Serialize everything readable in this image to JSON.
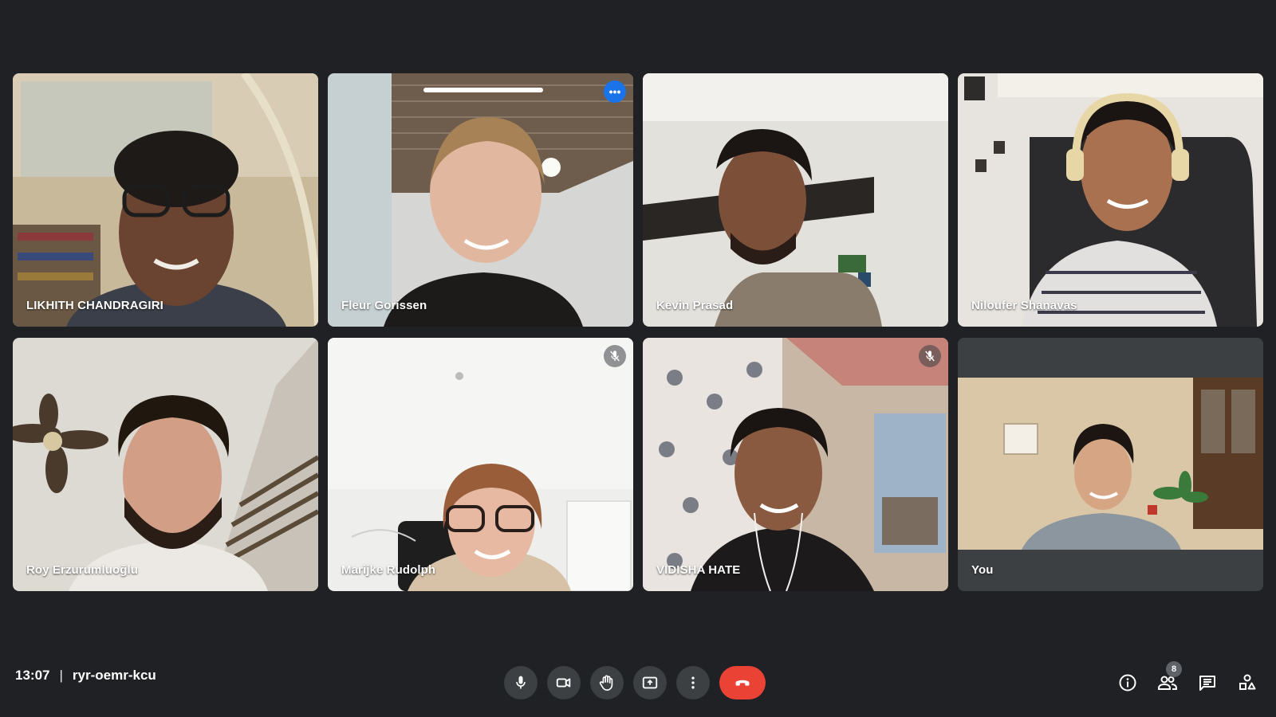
{
  "participants": [
    {
      "name": "LIKHITH CHANDRAGIRI"
    },
    {
      "name": "Fleur Gorissen"
    },
    {
      "name": "Kevin Prasad"
    },
    {
      "name": "Niloufer Shanavas"
    },
    {
      "name": "Roy Erzurumluoğlu"
    },
    {
      "name": "Marijke Rudolph"
    },
    {
      "name": "VIDISHA HATE"
    },
    {
      "name": "You"
    }
  ],
  "meeting": {
    "time": "13:07",
    "code": "ryr-oemr-kcu"
  },
  "participant_count": "8",
  "icons": {
    "mic": "mic-icon",
    "camera": "camera-icon",
    "raise_hand": "hand-icon",
    "present": "present-icon",
    "more": "more-vert-icon",
    "end_call": "end-call-icon",
    "info": "info-icon",
    "people": "people-icon",
    "chat": "chat-icon",
    "activities": "activities-icon"
  },
  "colors": {
    "background": "#202124",
    "active_speaker": "#8ab4f8",
    "end_call": "#ea4335",
    "control": "#3c4043"
  }
}
